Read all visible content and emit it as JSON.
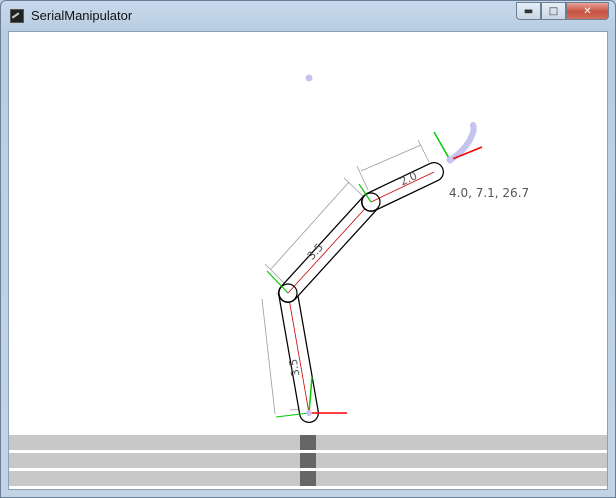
{
  "window": {
    "title": "SerialManipulator",
    "minimize_icon": "minimize-icon",
    "maximize_icon": "maximize-icon",
    "close_icon": "close-icon"
  },
  "scene": {
    "link_labels": [
      "3.5",
      "3.5",
      "2.0"
    ],
    "end_effector_readout": "4.0, 7.1, 26.7",
    "colors": {
      "link_outline": "#000000",
      "x_axis": "#ff0000",
      "y_axis": "#00cc00",
      "trail": "#c4c4ee",
      "dimension_lines": "#9a9a9a",
      "readout_text": "#555555"
    }
  },
  "sliders": [
    {
      "name": "joint-1-slider",
      "value_fraction": 0.5
    },
    {
      "name": "joint-2-slider",
      "value_fraction": 0.5
    },
    {
      "name": "joint-3-slider",
      "value_fraction": 0.5
    }
  ]
}
